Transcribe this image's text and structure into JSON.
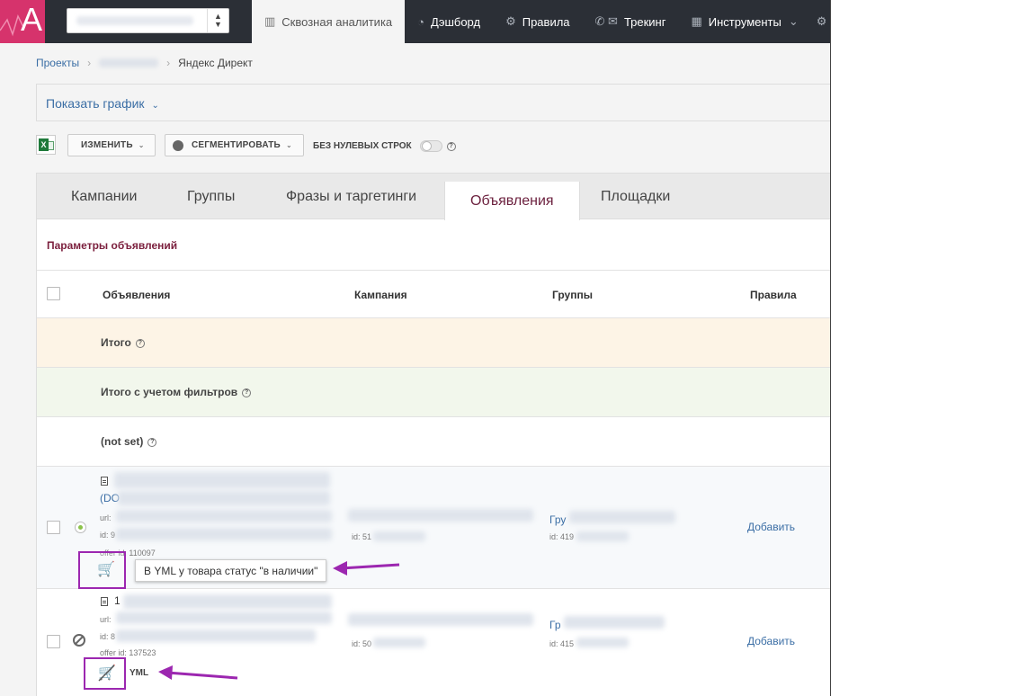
{
  "topbar": {
    "logo_letter": "A",
    "nav": [
      {
        "label": "Сквозная аналитика",
        "icon": "bar-chart-icon",
        "active": true
      },
      {
        "label": "Дэшборд",
        "icon": "gauge-icon"
      },
      {
        "label": "Правила",
        "icon": "gears-icon"
      },
      {
        "label": "Трекинг",
        "icon": "phone-mail-icon"
      },
      {
        "label": "Инструменты",
        "icon": "grid-icon"
      }
    ],
    "tools_caret": "⌄"
  },
  "breadcrumb": {
    "projects": "Проекты",
    "current": "Яндекс Директ"
  },
  "show_chart": "Показать график",
  "toolbar": {
    "edit_label": "ИЗМЕНИТЬ",
    "segment_label": "СЕГМЕНТИРОВАТЬ",
    "nonzero_label": "БЕЗ НУЛЕВЫХ СТРОК"
  },
  "tabs": [
    "Кампании",
    "Группы",
    "Фразы и таргетинги",
    "Объявления",
    "Площадки"
  ],
  "params_title": "Параметры объявлений",
  "table": {
    "headers": {
      "ads": "Объявления",
      "campaign": "Кампания",
      "groups": "Группы",
      "rules": "Правила"
    },
    "total": "Итого",
    "total_filtered": "Итого с учетом фильтров",
    "not_set": "(not set)",
    "rows": [
      {
        "title_visible": "(DO",
        "url_prefix": "url:",
        "id_prefix": "id: 9",
        "offer": "offer id: 110097",
        "campaign_id": "id: 51",
        "group_name": "Гру",
        "group_id": "id: 419",
        "add": "Добавить",
        "status": "active"
      },
      {
        "title_visible": "1",
        "url_prefix": "url:",
        "id_prefix": "id: 8",
        "offer": "offer id: 137523",
        "campaign_id": "id: 50",
        "group_name": "Гр",
        "group_id": "id: 415",
        "add": "Добавить",
        "status": "disabled",
        "yml": "YML"
      }
    ]
  },
  "tooltip": "В YML у товара статус \"в наличии\"",
  "accent_colors": {
    "logo": "#d6336c",
    "highlight": "#9c27b0",
    "link": "#3b6ea5",
    "title": "#7b1f3d"
  }
}
